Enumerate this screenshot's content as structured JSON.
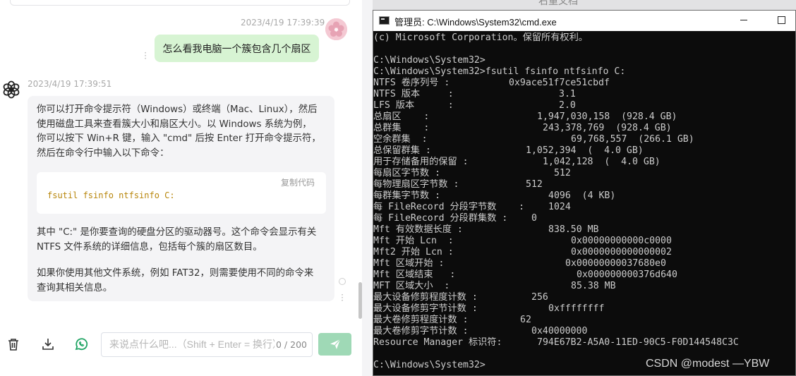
{
  "chat": {
    "user_timestamp": "2023/4/19 17:39:39",
    "user_message": "怎么看我电脑一个簇包含几个扇区",
    "ai_timestamp": "2023/4/19 17:39:51",
    "ai_paragraph_1": [
      "你可以打开命令提示符（Windows）或终端（Mac、Linux），然后",
      "使用磁盘工具来查看簇大小和扇区大小。以 Windows 系统为例，",
      "你可以按下 Win+R 键，输入 \"cmd\" 后按 Enter 打开命令提示符，",
      "然后在命令行中输入以下命令："
    ],
    "copy_code_label": "复制代码",
    "code": "fsutil fsinfo ntfsinfo C:",
    "ai_paragraph_2": [
      "其中 \"C:\" 是你要查询的硬盘分区的驱动器号。这个命令会显示有关",
      "NTFS 文件系统的详细信息，包括每个簇的扇区数目。"
    ],
    "ai_paragraph_3": [
      "如果你使用其他文件系统，例如 FAT32，则需要使用不同的命令来",
      "查询其相关信息。"
    ],
    "input_placeholder": "来说点什么吧...（Shift + Enter = 换行）",
    "char_counter": "0 / 200",
    "icons": [
      "trash-icon",
      "download-icon",
      "whatsapp-icon",
      "send-icon"
    ]
  },
  "background_window_title": "右重文档",
  "cmd": {
    "title": "管理员: C:\\Windows\\System32\\cmd.exe",
    "lines": [
      {
        "label": "(c) Microsoft Corporation。保留所有权利。",
        "value": ""
      },
      {
        "label": "",
        "value": ""
      },
      {
        "label": "C:\\Windows\\System32>",
        "value": ""
      },
      {
        "label": "C:\\Windows\\System32>fsutil fsinfo ntfsinfo C:",
        "value": ""
      },
      {
        "label": "NTFS 卷序列号 :",
        "value": "0x9ace51f7ce51cbdf"
      },
      {
        "label": "NTFS 版本     :",
        "value": "3.1"
      },
      {
        "label": "LFS 版本      :",
        "value": "2.0"
      },
      {
        "label": "总扇区    :",
        "value": "1,947,030,158  (928.4 GB)"
      },
      {
        "label": "总群集    :",
        "value": "243,378,769  (928.4 GB)"
      },
      {
        "label": "空余群集  :",
        "value": "69,768,557  (266.1 GB)"
      },
      {
        "label": "总保留群集 :",
        "value": "1,052,394  (  4.0 GB)"
      },
      {
        "label": "用于存储备用的保留 :",
        "value": "1,042,128  (  4.0 GB)"
      },
      {
        "label": "每扇区字节数 :",
        "value": "512"
      },
      {
        "label": "每物理扇区字节数 :",
        "value": "512"
      },
      {
        "label": "每群集字节数 :",
        "value": "4096  (4 KB)"
      },
      {
        "label": "每 FileRecord 分段字节数    :",
        "value": "1024"
      },
      {
        "label": "每 FileRecord 分段群集数 :",
        "value": "0"
      },
      {
        "label": "Mft 有效数据长度 :",
        "value": "838.50 MB"
      },
      {
        "label": "Mft 开始 Lcn  :",
        "value": "0x00000000000c0000"
      },
      {
        "label": "Mft2 开始 Lcn :",
        "value": "0x0000000000000002"
      },
      {
        "label": "Mft 区域开始 :",
        "value": "0x00000000037680e0"
      },
      {
        "label": "Mft 区域结束   :",
        "value": "0x000000000376d640"
      },
      {
        "label": "MFT 区域大小  :",
        "value": "85.38 MB"
      },
      {
        "label": "最大设备修剪程度计数 :",
        "value": "256"
      },
      {
        "label": "最大设备修剪字节计数 :",
        "value": "0xffffffff"
      },
      {
        "label": "最大卷修剪程度计数 :",
        "value": "62"
      },
      {
        "label": "最大卷修剪字节计数 :",
        "value": "0x40000000"
      },
      {
        "label": "Resource Manager 标识符:",
        "value": "794E67B2-A5A0-11ED-90C5-F0D144548C3C"
      },
      {
        "label": "",
        "value": ""
      },
      {
        "label": "C:\\Windows\\System32>",
        "value": ""
      }
    ]
  },
  "watermark": "CSDN @modest —YBW"
}
